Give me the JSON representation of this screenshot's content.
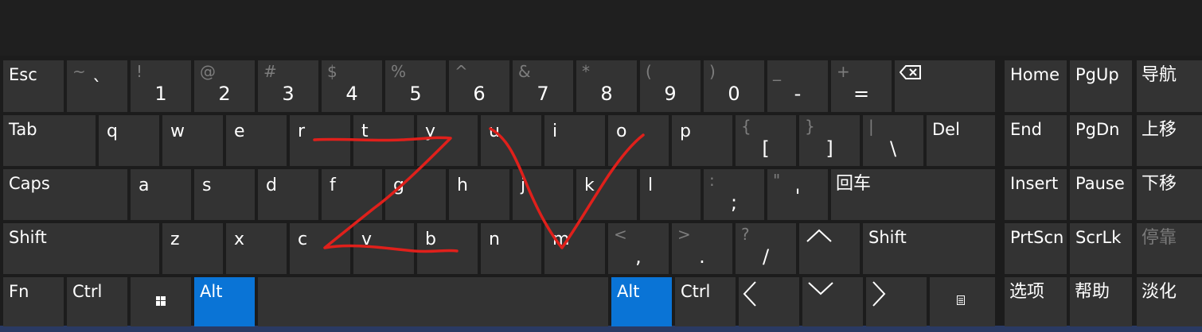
{
  "title": "",
  "keyboard": {
    "esc": "Esc",
    "tab": "Tab",
    "caps": "Caps",
    "shift": "Shift",
    "fn": "Fn",
    "ctrl": "Ctrl",
    "alt": "Alt",
    "del": "Del",
    "enter": "回车",
    "nav": {
      "home": "Home",
      "pgup": "PgUp",
      "navigate": "导航",
      "end": "End",
      "pgdn": "PgDn",
      "move_up": "上移",
      "insert": "Insert",
      "pause": "Pause",
      "move_down": "下移",
      "prtscn": "PrtScn",
      "scrlk": "ScrLk",
      "dock": "停靠",
      "options": "选项",
      "help": "帮助",
      "fade": "淡化"
    },
    "number_row": [
      {
        "shift": "~",
        "main": "`"
      },
      {
        "shift": "!",
        "main": "1"
      },
      {
        "shift": "@",
        "main": "2"
      },
      {
        "shift": "#",
        "main": "3"
      },
      {
        "shift": "$",
        "main": "4"
      },
      {
        "shift": "%",
        "main": "5"
      },
      {
        "shift": "^",
        "main": "6"
      },
      {
        "shift": "&",
        "main": "7"
      },
      {
        "shift": "*",
        "main": "8"
      },
      {
        "shift": "(",
        "main": "9"
      },
      {
        "shift": ")",
        "main": "0"
      },
      {
        "shift": "_",
        "main": "-"
      },
      {
        "shift": "+",
        "main": "="
      }
    ],
    "row_q": [
      "q",
      "w",
      "e",
      "r",
      "t",
      "y",
      "u",
      "i",
      "o",
      "p"
    ],
    "row_q_symbols": [
      {
        "shift": "{",
        "main": "["
      },
      {
        "shift": "}",
        "main": "]"
      },
      {
        "shift": "|",
        "main": "\\"
      }
    ],
    "row_a": [
      "a",
      "s",
      "d",
      "f",
      "g",
      "h",
      "j",
      "k",
      "l"
    ],
    "row_a_symbols": [
      {
        "shift": ":",
        "main": ";"
      },
      {
        "shift": "\"",
        "main": "'"
      }
    ],
    "row_z": [
      "z",
      "x",
      "c",
      "v",
      "b",
      "n",
      "m"
    ],
    "row_z_symbols": [
      {
        "shift": "<",
        "main": ","
      },
      {
        "shift": ">",
        "main": "."
      },
      {
        "shift": "?",
        "main": "/"
      }
    ]
  },
  "icons": {
    "backspace": "backspace-icon",
    "windows": "windows-logo-icon",
    "up": "arrow-up-icon",
    "left": "arrow-left-icon",
    "down": "arrow-down-icon",
    "right": "arrow-right-icon",
    "menu": "context-menu-icon"
  },
  "colors": {
    "background": "#1c1c1c",
    "key": "#333333",
    "accent": "#0a74d6",
    "secondary_text": "#7d7d7d",
    "annotation": "#e0201b"
  },
  "annotation": {
    "description_color": "#e0201b"
  }
}
